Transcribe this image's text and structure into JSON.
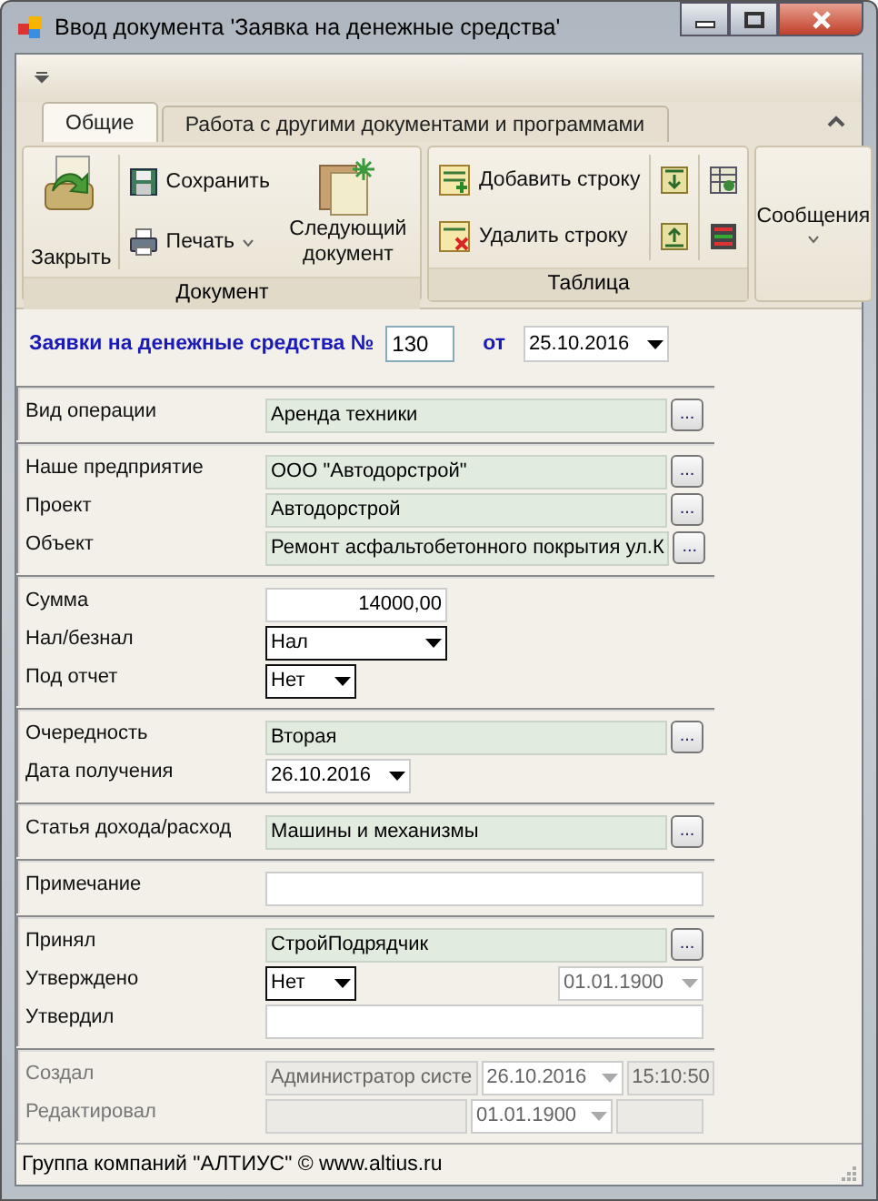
{
  "window": {
    "title": "Ввод документа 'Заявка на денежные средства'"
  },
  "ribbon": {
    "tabs": [
      {
        "label": "Общие",
        "selected": true
      },
      {
        "label": "Работа с другими документами и программами",
        "selected": false
      }
    ],
    "document_group": {
      "label": "Документ",
      "close_button": "Закрыть",
      "save_button": "Сохранить",
      "print_button": "Печать",
      "next_button": "Следующий документ"
    },
    "table_group": {
      "label": "Таблица",
      "add_row_button": "Добавить строку",
      "delete_row_button": "Удалить строку"
    },
    "messages_button": "Сообщения"
  },
  "header": {
    "label": "Заявки на денежные средства №",
    "number": "130",
    "date_label": "от",
    "date": "25.10.2016"
  },
  "sections": [
    {
      "rows": [
        {
          "label": "Вид операции",
          "disabled": false,
          "controls": [
            {
              "kind": "lookup",
              "value": "Аренда техники",
              "button": "..."
            }
          ]
        }
      ]
    },
    {
      "rows": [
        {
          "label": "Наше предприятие",
          "disabled": false,
          "controls": [
            {
              "kind": "lookup",
              "value": "ООО \"Автодорстрой\"",
              "button": "..."
            }
          ]
        },
        {
          "label": "Проект",
          "disabled": false,
          "controls": [
            {
              "kind": "lookup",
              "value": "Автодорстрой",
              "button": "..."
            }
          ]
        },
        {
          "label": "Объект",
          "disabled": false,
          "controls": [
            {
              "kind": "lookup",
              "value": "Ремонт асфальтобетонного покрытия ул.К",
              "button": "..."
            }
          ]
        }
      ]
    },
    {
      "rows": [
        {
          "label": "Сумма",
          "disabled": false,
          "controls": [
            {
              "kind": "amount",
              "value": "14000,00"
            }
          ]
        },
        {
          "label": "Нал/безнал",
          "disabled": false,
          "controls": [
            {
              "kind": "select",
              "value": "Нал"
            }
          ]
        },
        {
          "label": "Под отчет",
          "disabled": false,
          "controls": [
            {
              "kind": "select-short",
              "value": "Нет"
            }
          ]
        }
      ]
    },
    {
      "rows": [
        {
          "label": "Очередность",
          "disabled": false,
          "controls": [
            {
              "kind": "lookup",
              "value": "Вторая",
              "button": "..."
            }
          ]
        },
        {
          "label": "Дата получения",
          "disabled": false,
          "controls": [
            {
              "kind": "date",
              "value": "26.10.2016"
            }
          ]
        }
      ]
    },
    {
      "rows": [
        {
          "label": "Статья дохода/расход",
          "disabled": false,
          "controls": [
            {
              "kind": "lookup",
              "value": "Машины и механизмы",
              "button": "..."
            }
          ]
        }
      ]
    },
    {
      "rows": [
        {
          "label": "Примечание",
          "disabled": false,
          "controls": [
            {
              "kind": "text"
            }
          ]
        }
      ]
    },
    {
      "rows": [
        {
          "label": "Принял",
          "disabled": false,
          "controls": [
            {
              "kind": "lookup",
              "value": "СтройПодрядчик",
              "button": "..."
            }
          ]
        },
        {
          "label": "Утверждено",
          "disabled": false,
          "controls": [
            {
              "kind": "select-short",
              "value": "Нет"
            },
            {
              "kind": "date-right",
              "value": "01.01.1900"
            }
          ]
        },
        {
          "label": "Утвердил",
          "disabled": false,
          "controls": [
            {
              "kind": "text"
            }
          ]
        }
      ]
    },
    {
      "rows": [
        {
          "label": "Создал",
          "disabled": true,
          "controls": [
            {
              "kind": "readonly",
              "value": "Администратор систе"
            },
            {
              "kind": "date-grey",
              "value": "26.10.2016"
            },
            {
              "kind": "time",
              "value": "15:10:50"
            }
          ]
        },
        {
          "label": "Редактировал",
          "disabled": true,
          "controls": [
            {
              "kind": "readonly"
            },
            {
              "kind": "date-grey",
              "value": "01.01.1900"
            },
            {
              "kind": "time"
            }
          ]
        }
      ]
    }
  ],
  "status_bar": {
    "text": "Группа компаний \"АЛТИУС\" © www.altius.ru"
  }
}
